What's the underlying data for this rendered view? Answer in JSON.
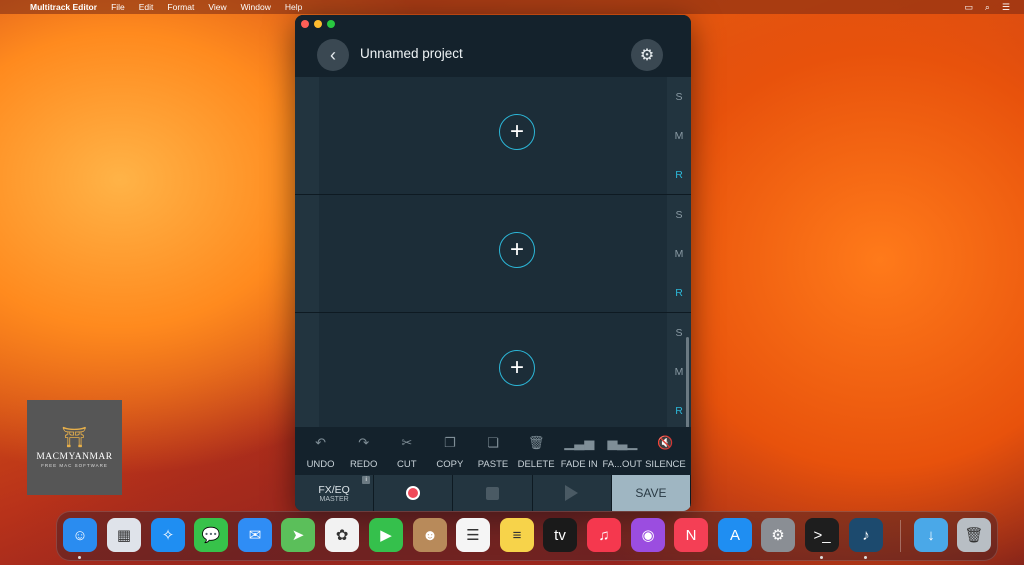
{
  "menubar": {
    "app_name": "Multitrack Editor",
    "items": [
      "File",
      "Edit",
      "Format",
      "View",
      "Window",
      "Help"
    ]
  },
  "window": {
    "title": "Unnamed project",
    "tracks": [
      {
        "s": "S",
        "m": "M",
        "r": "R"
      },
      {
        "s": "S",
        "m": "M",
        "r": "R"
      },
      {
        "s": "S",
        "m": "M",
        "r": "R"
      }
    ],
    "toolbar": [
      {
        "label": "UNDO",
        "icon": "undo-icon",
        "glyph": "↶"
      },
      {
        "label": "REDO",
        "icon": "redo-icon",
        "glyph": "↷"
      },
      {
        "label": "CUT",
        "icon": "scissors-icon",
        "glyph": "✂"
      },
      {
        "label": "COPY",
        "icon": "copy-icon",
        "glyph": "❐"
      },
      {
        "label": "PASTE",
        "icon": "paste-icon",
        "glyph": "❏"
      },
      {
        "label": "DELETE",
        "icon": "trash-icon",
        "glyph": "🗑"
      },
      {
        "label": "FADE IN",
        "icon": "fade-in-icon",
        "glyph": "▁▃▅"
      },
      {
        "label": "FA...OUT",
        "icon": "fade-out-icon",
        "glyph": "▅▃▁"
      },
      {
        "label": "SILENCE",
        "icon": "mute-icon",
        "glyph": "🔇"
      }
    ],
    "bottombar": {
      "fx_label": "FX/EQ",
      "fx_sub": "MASTER",
      "save_label": "SAVE"
    }
  },
  "watermark": {
    "name": "MACMYANMAR",
    "tagline": "FREE MAC SOFTWARE"
  },
  "dock": [
    {
      "name": "finder-icon",
      "color": "#2a8cf0",
      "glyph": "☺",
      "dot": true
    },
    {
      "name": "launchpad-icon",
      "color": "#dfe3ea",
      "glyph": "▦",
      "dot": false
    },
    {
      "name": "safari-icon",
      "color": "#1f8ef2",
      "glyph": "✧",
      "dot": false
    },
    {
      "name": "messages-icon",
      "color": "#37c24a",
      "glyph": "💬",
      "dot": false
    },
    {
      "name": "mail-icon",
      "color": "#2f8df5",
      "glyph": "✉",
      "dot": false
    },
    {
      "name": "maps-icon",
      "color": "#5bbf5a",
      "glyph": "➤",
      "dot": false
    },
    {
      "name": "photos-icon",
      "color": "#f2f2f2",
      "glyph": "✿",
      "dot": false
    },
    {
      "name": "facetime-icon",
      "color": "#35c04c",
      "glyph": "▶",
      "dot": false
    },
    {
      "name": "contacts-icon",
      "color": "#b88a5a",
      "glyph": "☻",
      "dot": false
    },
    {
      "name": "reminders-icon",
      "color": "#f5f5f5",
      "glyph": "☰",
      "dot": false
    },
    {
      "name": "notes-icon",
      "color": "#f7d34a",
      "glyph": "≡",
      "dot": false
    },
    {
      "name": "apple-tv-icon",
      "color": "#1a1a1a",
      "glyph": "tv",
      "dot": false
    },
    {
      "name": "music-icon",
      "color": "#f5384e",
      "glyph": "♫",
      "dot": false
    },
    {
      "name": "podcasts-icon",
      "color": "#9b4de0",
      "glyph": "◉",
      "dot": false
    },
    {
      "name": "news-icon",
      "color": "#f43f55",
      "glyph": "N",
      "dot": false
    },
    {
      "name": "app-store-icon",
      "color": "#1f8ef2",
      "glyph": "A",
      "dot": false
    },
    {
      "name": "system-settings-icon",
      "color": "#8a8e94",
      "glyph": "⚙",
      "dot": false
    },
    {
      "name": "terminal-icon",
      "color": "#1e1e1e",
      "glyph": ">_",
      "dot": true
    },
    {
      "name": "multitrack-editor-icon",
      "color": "#1c4a6e",
      "glyph": "♪",
      "dot": true
    },
    {
      "name": "downloads-folder-icon",
      "color": "#4aa8e8",
      "glyph": "↓",
      "dot": false
    },
    {
      "name": "trash-icon",
      "color": "#b8bec4",
      "glyph": "🗑",
      "dot": false
    }
  ]
}
